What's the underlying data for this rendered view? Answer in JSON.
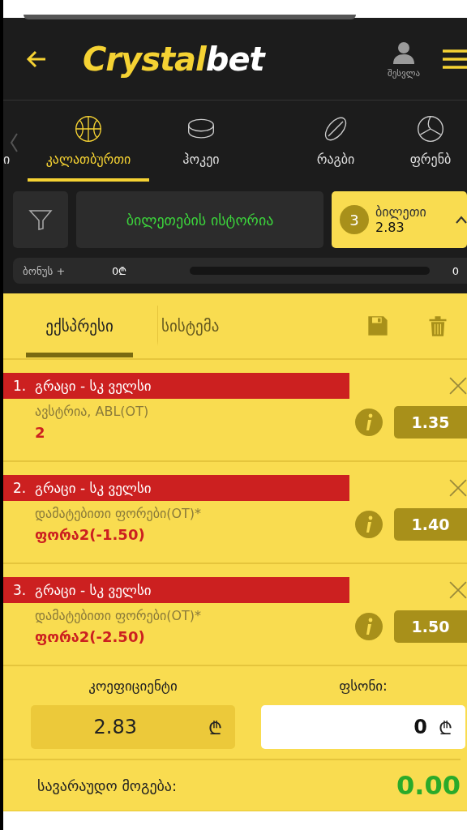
{
  "header": {
    "logo_main": "Crystal",
    "logo_accent": "bet",
    "login_label": "შესვლა"
  },
  "sport_tabs": [
    {
      "label": "ი",
      "selected": false,
      "kind": "none"
    },
    {
      "label": "კალათბურთი",
      "selected": true,
      "kind": "basketball"
    },
    {
      "label": "ჰოკეი",
      "selected": false,
      "kind": "puck"
    },
    {
      "label": "რაგბი",
      "selected": false,
      "kind": "rugby"
    },
    {
      "label": "ფრენბ",
      "selected": false,
      "kind": "volleyball"
    }
  ],
  "history_button": "ბილეთების ისტორია",
  "ticket": {
    "count": "3",
    "label": "ბილეთი",
    "odds": "2.83"
  },
  "bonus": {
    "label": "ბონუს +",
    "amount": "0₾",
    "reading": "0"
  },
  "bet_tabs": [
    {
      "label": "ექსპრესი",
      "selected": true
    },
    {
      "label": "სისტემა",
      "selected": false
    }
  ],
  "bets": [
    {
      "title": "1.  გრაცი - სკ ველსი",
      "market": "ავსტრია, ABL(OT)",
      "pick": "2",
      "odds": "1.35"
    },
    {
      "title": "2.  გრაცი - სკ ველსი",
      "market": "დამატებითი ფორები(OT)*",
      "pick": "ფორა2(-1.50)",
      "odds": "1.40"
    },
    {
      "title": "3.  გრაცი - სკ ველსი",
      "market": "დამატებითი ფორები(OT)*",
      "pick": "ფორა2(-2.50)",
      "odds": "1.50"
    }
  ],
  "coefficient": {
    "label": "კოეფიციენტი",
    "value": "2.83",
    "currency": "₾"
  },
  "stake": {
    "label": "ფსონი:",
    "value": "0",
    "currency": "₾"
  },
  "possible_win": {
    "label": "სავარაუდო მოგება:",
    "value": "0.00"
  }
}
